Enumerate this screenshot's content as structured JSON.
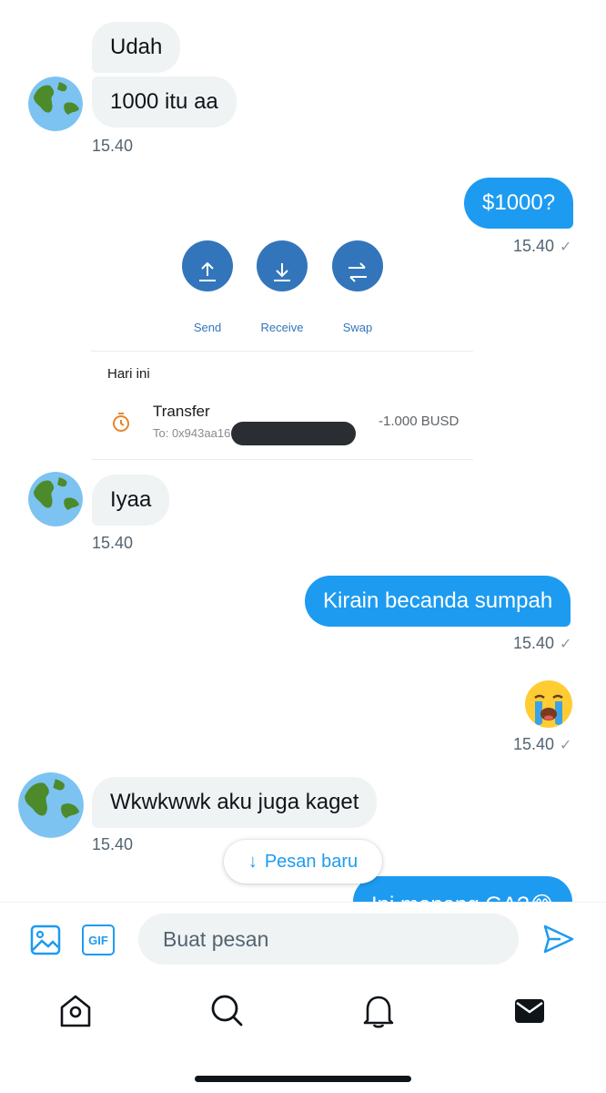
{
  "messages": {
    "m1_text": "Udah",
    "m2_text": "1000 itu aa",
    "t1": "15.40",
    "m3_text": "$1000?",
    "t2": "15.40",
    "m4_text": "Iyaa",
    "t3": "15.40",
    "m5_text": "Kirain becanda sumpah",
    "t4": "15.40",
    "m6_text": "😭",
    "t5": "15.40",
    "m7_text": "Wkwkwwk aku juga kaget",
    "t6": "15.40",
    "m8_text": "Ini menang GA?😂"
  },
  "wallet": {
    "send_label": "Send",
    "receive_label": "Receive",
    "swap_label": "Swap",
    "section_label": "Hari ini",
    "tx_title": "Transfer",
    "tx_to": "To: 0x943aa16",
    "tx_amount": "-1.000 BUSD"
  },
  "new_messages_pill": "Pesan baru",
  "composer": {
    "placeholder": "Buat pesan",
    "gif_label": "GIF"
  },
  "colors": {
    "accent": "#1d9bf0",
    "bubble_in": "#eff3f4",
    "wallet_blue": "#3375bb"
  }
}
